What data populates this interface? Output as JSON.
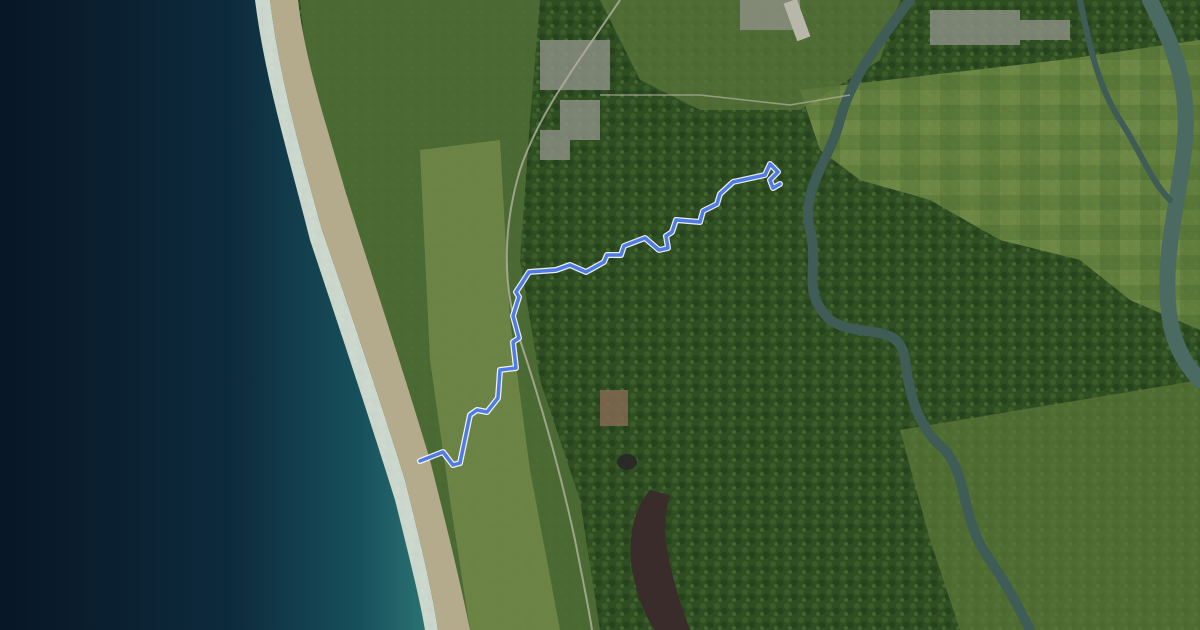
{
  "map": {
    "view": "satellite",
    "colors": {
      "route": "#4f7be8",
      "route_casing": "#ffffff",
      "ocean_deep": "#0b1a2c",
      "ocean_shallow": "#1b5a63",
      "surf": "#e8f1ee",
      "beach": "#b5ad8d",
      "land": "#3f5f2d",
      "forest": "#2e4d22",
      "pasture": "#6f8a45",
      "river": "#3d5a55",
      "lake": "#3a2c2a",
      "town": "#9a9a8c"
    }
  },
  "route": {
    "type": "track",
    "start_side": "west",
    "end_side": "east"
  }
}
